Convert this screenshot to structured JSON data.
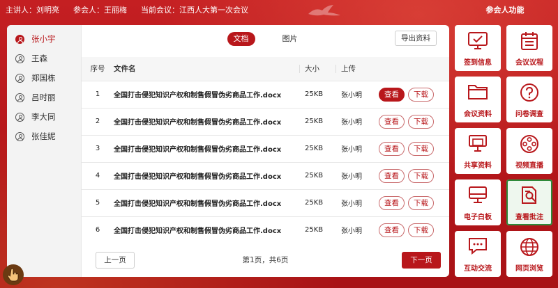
{
  "top": {
    "speaker_label": "主讲人：刘明亮",
    "attendee_label": "参会人：王丽梅",
    "meeting_label": "当前会议：江西人大第一次会议",
    "right_title": "参会人功能"
  },
  "members": [
    {
      "name": "张小宇",
      "active": true
    },
    {
      "name": "王森"
    },
    {
      "name": "郑国栋"
    },
    {
      "name": "吕时丽"
    },
    {
      "name": "李大同"
    },
    {
      "name": "张佳妮"
    }
  ],
  "tabs": [
    {
      "label": "文档",
      "active": true
    },
    {
      "label": "图片"
    }
  ],
  "export_label": "导出资料",
  "table": {
    "headers": {
      "idx": "序号",
      "name": "文件名",
      "size": "大小",
      "uploader": "上传"
    },
    "rows": [
      {
        "idx": "1",
        "name": "全国打击侵犯知识产权和制售假冒伪劣商品工作.docx",
        "size": "25KB",
        "uploader": "张小明",
        "view": "查看",
        "download": "下载"
      },
      {
        "idx": "2",
        "name": "全国打击侵犯知识产权和制售假冒伪劣商品工作.docx",
        "size": "25KB",
        "uploader": "张小明",
        "view": "查看",
        "download": "下载"
      },
      {
        "idx": "3",
        "name": "全国打击侵犯知识产权和制售假冒伪劣商品工作.docx",
        "size": "25KB",
        "uploader": "张小明",
        "view": "查看",
        "download": "下载"
      },
      {
        "idx": "4",
        "name": "全国打击侵犯知识产权和制售假冒伪劣商品工作.docx",
        "size": "25KB",
        "uploader": "张小明",
        "view": "查看",
        "download": "下载"
      },
      {
        "idx": "5",
        "name": "全国打击侵犯知识产权和制售假冒伪劣商品工作.docx",
        "size": "25KB",
        "uploader": "张小明",
        "view": "查看",
        "download": "下载"
      },
      {
        "idx": "6",
        "name": "全国打击侵犯知识产权和制售假冒伪劣商品工作.docx",
        "size": "25KB",
        "uploader": "张小明",
        "view": "查看",
        "download": "下载"
      }
    ]
  },
  "pager": {
    "prev": "上一页",
    "info": "第1页，共6页",
    "next": "下一页"
  },
  "functions": [
    {
      "label": "签到信息",
      "icon": "monitor-check-icon"
    },
    {
      "label": "会议议程",
      "icon": "calendar-list-icon"
    },
    {
      "label": "会议资料",
      "icon": "folder-icon"
    },
    {
      "label": "问卷调查",
      "icon": "question-icon"
    },
    {
      "label": "共享资料",
      "icon": "share-screen-icon"
    },
    {
      "label": "视频直播",
      "icon": "film-reel-icon"
    },
    {
      "label": "电子白板",
      "icon": "whiteboard-icon"
    },
    {
      "label": "查看批注",
      "icon": "doc-search-icon",
      "active": true
    },
    {
      "label": "互动交流",
      "icon": "chat-icon"
    },
    {
      "label": "网页浏览",
      "icon": "globe-icon"
    }
  ],
  "colors": {
    "primary": "#b8171b",
    "active_tile_border": "#2e8a3a"
  }
}
